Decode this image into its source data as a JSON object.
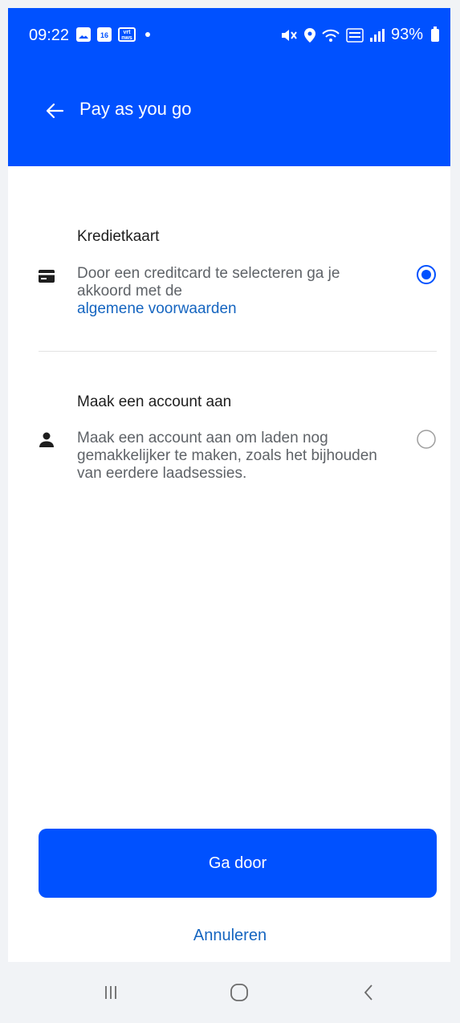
{
  "status_bar": {
    "time": "09:22",
    "calendar_day": "16",
    "vrt_label": "vrt nws",
    "battery": "93%"
  },
  "app_bar": {
    "title": "Pay as you go"
  },
  "options": [
    {
      "title": "Kredietkaart",
      "description": "Door een creditcard te selecteren ga je akkoord met de",
      "link": "algemene voorwaarden",
      "icon": "credit-card-icon",
      "selected": true
    },
    {
      "title": "Maak een account aan",
      "description": "Maak een account aan om laden nog gemakkelijker te maken, zoals het bijhouden van eerdere laadsessies.",
      "icon": "person-icon",
      "selected": false
    }
  ],
  "actions": {
    "continue_label": "Ga door",
    "cancel_label": "Annuleren"
  },
  "colors": {
    "primary": "#0051ff",
    "link": "#1565c0"
  }
}
